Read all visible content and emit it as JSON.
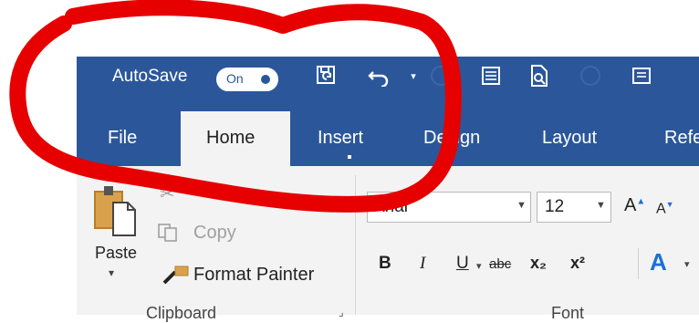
{
  "quick_access": {
    "autosave_label": "AutoSave",
    "autosave_state": "On",
    "icons": [
      "save-icon",
      "undo-icon",
      "undo-dropdown-icon",
      "circle-placeholder",
      "document-icon",
      "print-preview-icon",
      "circle-placeholder",
      "form-icon"
    ]
  },
  "tabs": [
    "File",
    "Home",
    "Insert",
    "Design",
    "Layout",
    "Refe"
  ],
  "active_tab": "Home",
  "clipboard": {
    "paste_label": "Paste",
    "cut_label": "Cut",
    "copy_label": "Copy",
    "format_painter_label": "Format Painter",
    "group_label": "Clipboard"
  },
  "font": {
    "font_name": "Arial",
    "font_size": "12",
    "bold": "B",
    "italic": "I",
    "underline": "U",
    "strikethrough": "abc",
    "subscript": "x₂",
    "superscript": "x²",
    "group_label": "Font"
  },
  "colors": {
    "ribbon_blue": "#2b579a",
    "ribbon_gray": "#f3f3f3",
    "annotation_red": "#e60000"
  }
}
